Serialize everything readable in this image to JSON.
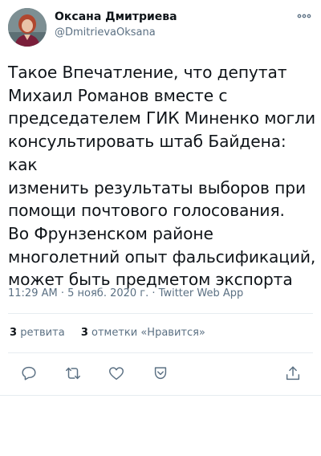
{
  "author": {
    "name": "Оксана Дмитриева",
    "handle": "@DmitrievaOksana"
  },
  "tweet": {
    "text": "Такое Впечатление, что депутат\nМихаил Романов вместе с\nпредседателем ГИК Миненко могли\nконсультировать штаб Байдена: как\nизменить результаты выборов при\nпомощи почтового голосования.\nВо Фрунзенском районе\nмноголетний опыт фальсификаций,\nможет быть предметом экспорта"
  },
  "meta": {
    "time": "11:29 AM",
    "separator1": " · ",
    "date": "5 нояб. 2020 г.",
    "separator2": " · ",
    "source": "Twitter Web App"
  },
  "stats": {
    "retweets_count": "3",
    "retweets_label": "ретвита",
    "likes_count": "3",
    "likes_label": "отметки «Нравится»"
  },
  "icons": {
    "more": "more-horizontal-icon",
    "reply": "reply-icon",
    "retweet": "retweet-icon",
    "like": "heart-icon",
    "bookmark": "bookmark-icon",
    "share": "share-icon"
  },
  "colors": {
    "text": "#0f1419",
    "secondary": "#5b7083",
    "border": "#e6ecf0"
  }
}
